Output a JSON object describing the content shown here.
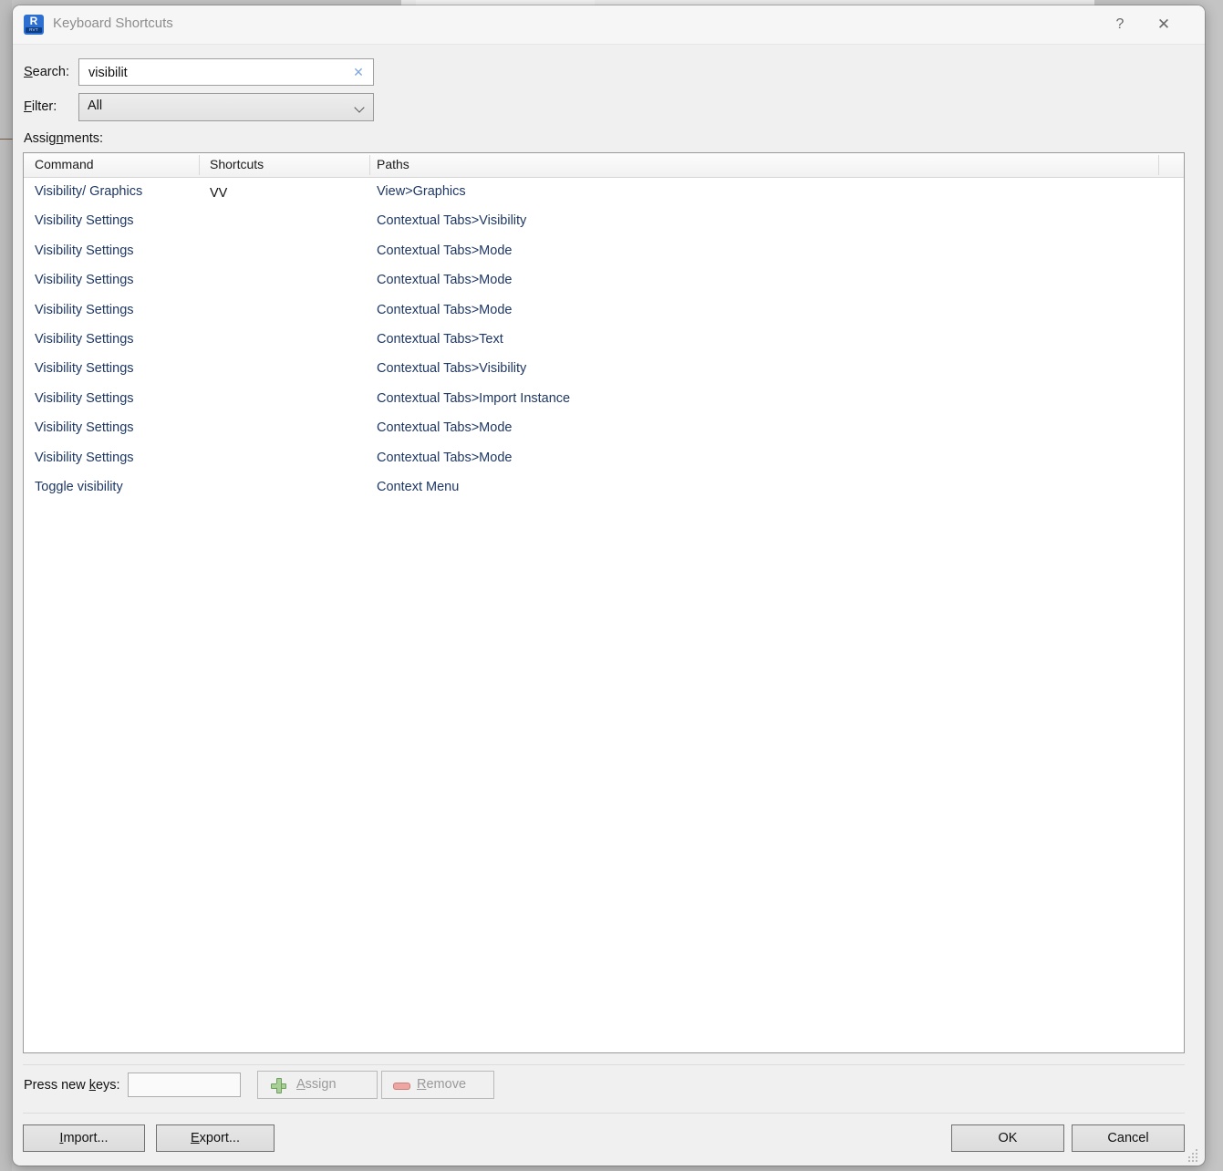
{
  "window": {
    "title": "Keyboard Shortcuts",
    "app_icon": "revit-app-icon",
    "icon_letter": "R",
    "icon_sublabel": "RVT",
    "help_glyph": "?",
    "close_glyph": "✕"
  },
  "search": {
    "label_prefix": "S",
    "label_rest": "earch:",
    "value": "visibilit",
    "placeholder": "",
    "clear_glyph": "✕"
  },
  "filter": {
    "label_prefix": "F",
    "label_rest": "ilter:",
    "selected": "All",
    "options": [
      "All"
    ]
  },
  "assignments": {
    "label_prefix": "Assig",
    "label_underline": "n",
    "label_suffix": "ments:",
    "columns": [
      "Command",
      "Shortcuts",
      "Paths"
    ],
    "rows": [
      {
        "command": "Visibility/ Graphics",
        "shortcut": "VV",
        "path": "View>Graphics"
      },
      {
        "command": "Visibility Settings",
        "shortcut": "",
        "path": "Contextual Tabs>Visibility"
      },
      {
        "command": "Visibility Settings",
        "shortcut": "",
        "path": "Contextual Tabs>Mode"
      },
      {
        "command": "Visibility Settings",
        "shortcut": "",
        "path": "Contextual Tabs>Mode"
      },
      {
        "command": "Visibility Settings",
        "shortcut": "",
        "path": "Contextual Tabs>Mode"
      },
      {
        "command": "Visibility Settings",
        "shortcut": "",
        "path": "Contextual Tabs>Text"
      },
      {
        "command": "Visibility Settings",
        "shortcut": "",
        "path": "Contextual Tabs>Visibility"
      },
      {
        "command": "Visibility Settings",
        "shortcut": "",
        "path": "Contextual Tabs>Import Instance"
      },
      {
        "command": "Visibility Settings",
        "shortcut": "",
        "path": "Contextual Tabs>Mode"
      },
      {
        "command": "Visibility Settings",
        "shortcut": "",
        "path": "Contextual Tabs>Mode"
      },
      {
        "command": "Toggle visibility",
        "shortcut": "",
        "path": "Context Menu"
      }
    ]
  },
  "press_keys": {
    "label_prefix": "Press new ",
    "label_underline": "k",
    "label_suffix": "eys:",
    "value": "",
    "placeholder": ""
  },
  "actions": {
    "assign_prefix": "A",
    "assign_rest": "ssign",
    "assign_icon": "plus-icon",
    "remove_prefix": "R",
    "remove_rest": "emove",
    "remove_icon": "minus-icon"
  },
  "footer": {
    "import_prefix": "I",
    "import_rest": "mport...",
    "export_prefix": "E",
    "export_rest": "xport...",
    "ok": "OK",
    "cancel": "Cancel"
  },
  "colors": {
    "link_text": "#1f3864",
    "dialog_bg": "#f0f0f0",
    "desktop_bg": "#c4c4c4",
    "accent_blue": "#2c6fd1",
    "assign_green": "#a8cf96",
    "remove_red": "#eda6a1"
  }
}
